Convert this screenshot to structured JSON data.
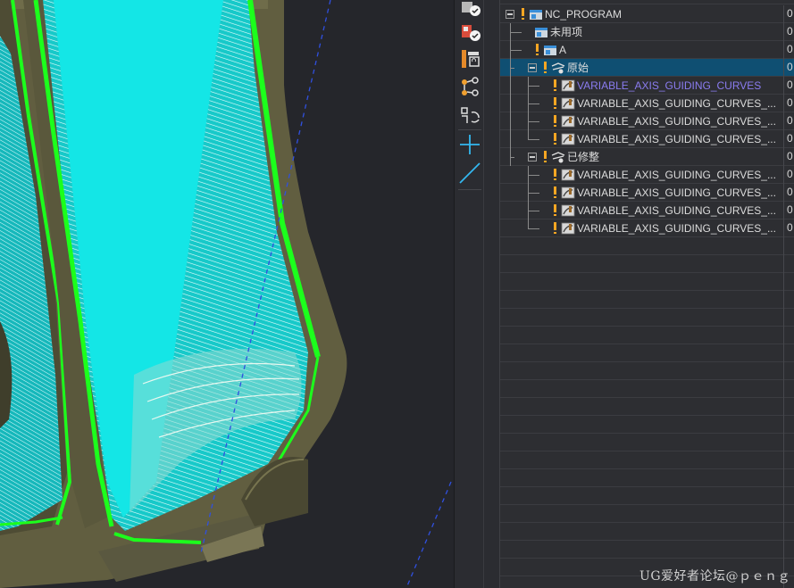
{
  "navigator": {
    "rows": [
      {
        "label": "NC_PROGRAM",
        "icon": "program-root-icon",
        "value": "0"
      },
      {
        "label": "未用项",
        "icon": "unused-folder-icon",
        "value": "0"
      },
      {
        "label": "A",
        "icon": "program-group-icon",
        "value": "0"
      },
      {
        "label": "原始",
        "icon": "method-group-icon",
        "value": "0"
      },
      {
        "label": "VARIABLE_AXIS_GUIDING_CURVES",
        "icon": "operation-icon",
        "value": "0"
      },
      {
        "label": "VARIABLE_AXIS_GUIDING_CURVES_...",
        "icon": "operation-icon",
        "value": "0"
      },
      {
        "label": "VARIABLE_AXIS_GUIDING_CURVES_...",
        "icon": "operation-icon",
        "value": "0"
      },
      {
        "label": "VARIABLE_AXIS_GUIDING_CURVES_...",
        "icon": "operation-icon",
        "value": "0"
      },
      {
        "label": "已修整",
        "icon": "method-group-icon",
        "value": "0"
      },
      {
        "label": "VARIABLE_AXIS_GUIDING_CURVES_...",
        "icon": "operation-icon",
        "value": "0"
      },
      {
        "label": "VARIABLE_AXIS_GUIDING_CURVES_...",
        "icon": "operation-icon",
        "value": "0"
      },
      {
        "label": "VARIABLE_AXIS_GUIDING_CURVES_...",
        "icon": "operation-icon",
        "value": "0"
      },
      {
        "label": "VARIABLE_AXIS_GUIDING_CURVES_...",
        "icon": "operation-icon",
        "value": "0"
      }
    ]
  },
  "toolbar": {
    "buttons": [
      "verify-tool-icon",
      "verify-machine-icon",
      "tool-list-icon",
      "node-branch-icon",
      "swap-order-icon",
      "add-point-icon",
      "line-tool-icon"
    ]
  },
  "watermark": "UG爱好者论坛@ｐｅｎｇ",
  "colors": {
    "toolpath_cyan": "#14e6e6",
    "boundary_green": "#1cff1c",
    "part_olive": "#5c5a3e",
    "selection_blue": "#0f4f72",
    "warning_orange": "#f6a623",
    "active_label": "#8a7cf0"
  }
}
